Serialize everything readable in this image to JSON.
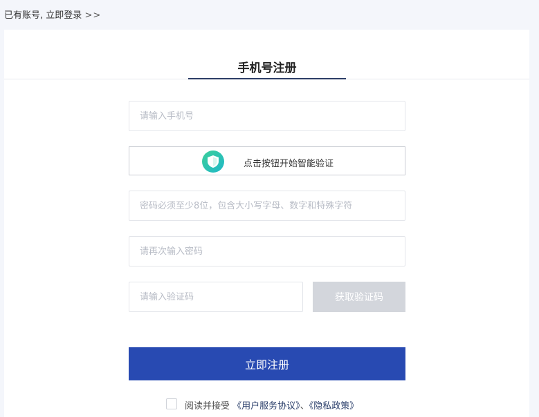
{
  "topbar": {
    "prefix": "已有账号,",
    "login_link": "立即登录",
    "arrows": ">>"
  },
  "tab": {
    "label": "手机号注册"
  },
  "form": {
    "phone_placeholder": "请输入手机号",
    "captcha_label": "点击按钮开始智能验证",
    "password_placeholder": "密码必须至少8位，包含大小写字母、数字和特殊字符",
    "password_confirm_placeholder": "请再次输入密码",
    "code_placeholder": "请输入验证码",
    "get_code_label": "获取验证码",
    "submit_label": "立即注册"
  },
  "agreement": {
    "prefix": "阅读并接受",
    "terms_link": "《用户服务协议》",
    "separator": "、",
    "privacy_link": "《隐私政策》"
  },
  "colors": {
    "primary": "#284ab2",
    "tab_underline": "#2c3e66",
    "disabled_button": "#d3d6dc",
    "shield_gradient_start": "#3ccf9a",
    "shield_gradient_end": "#1fb8c8"
  },
  "icons": {
    "captcha": "shield-icon"
  }
}
